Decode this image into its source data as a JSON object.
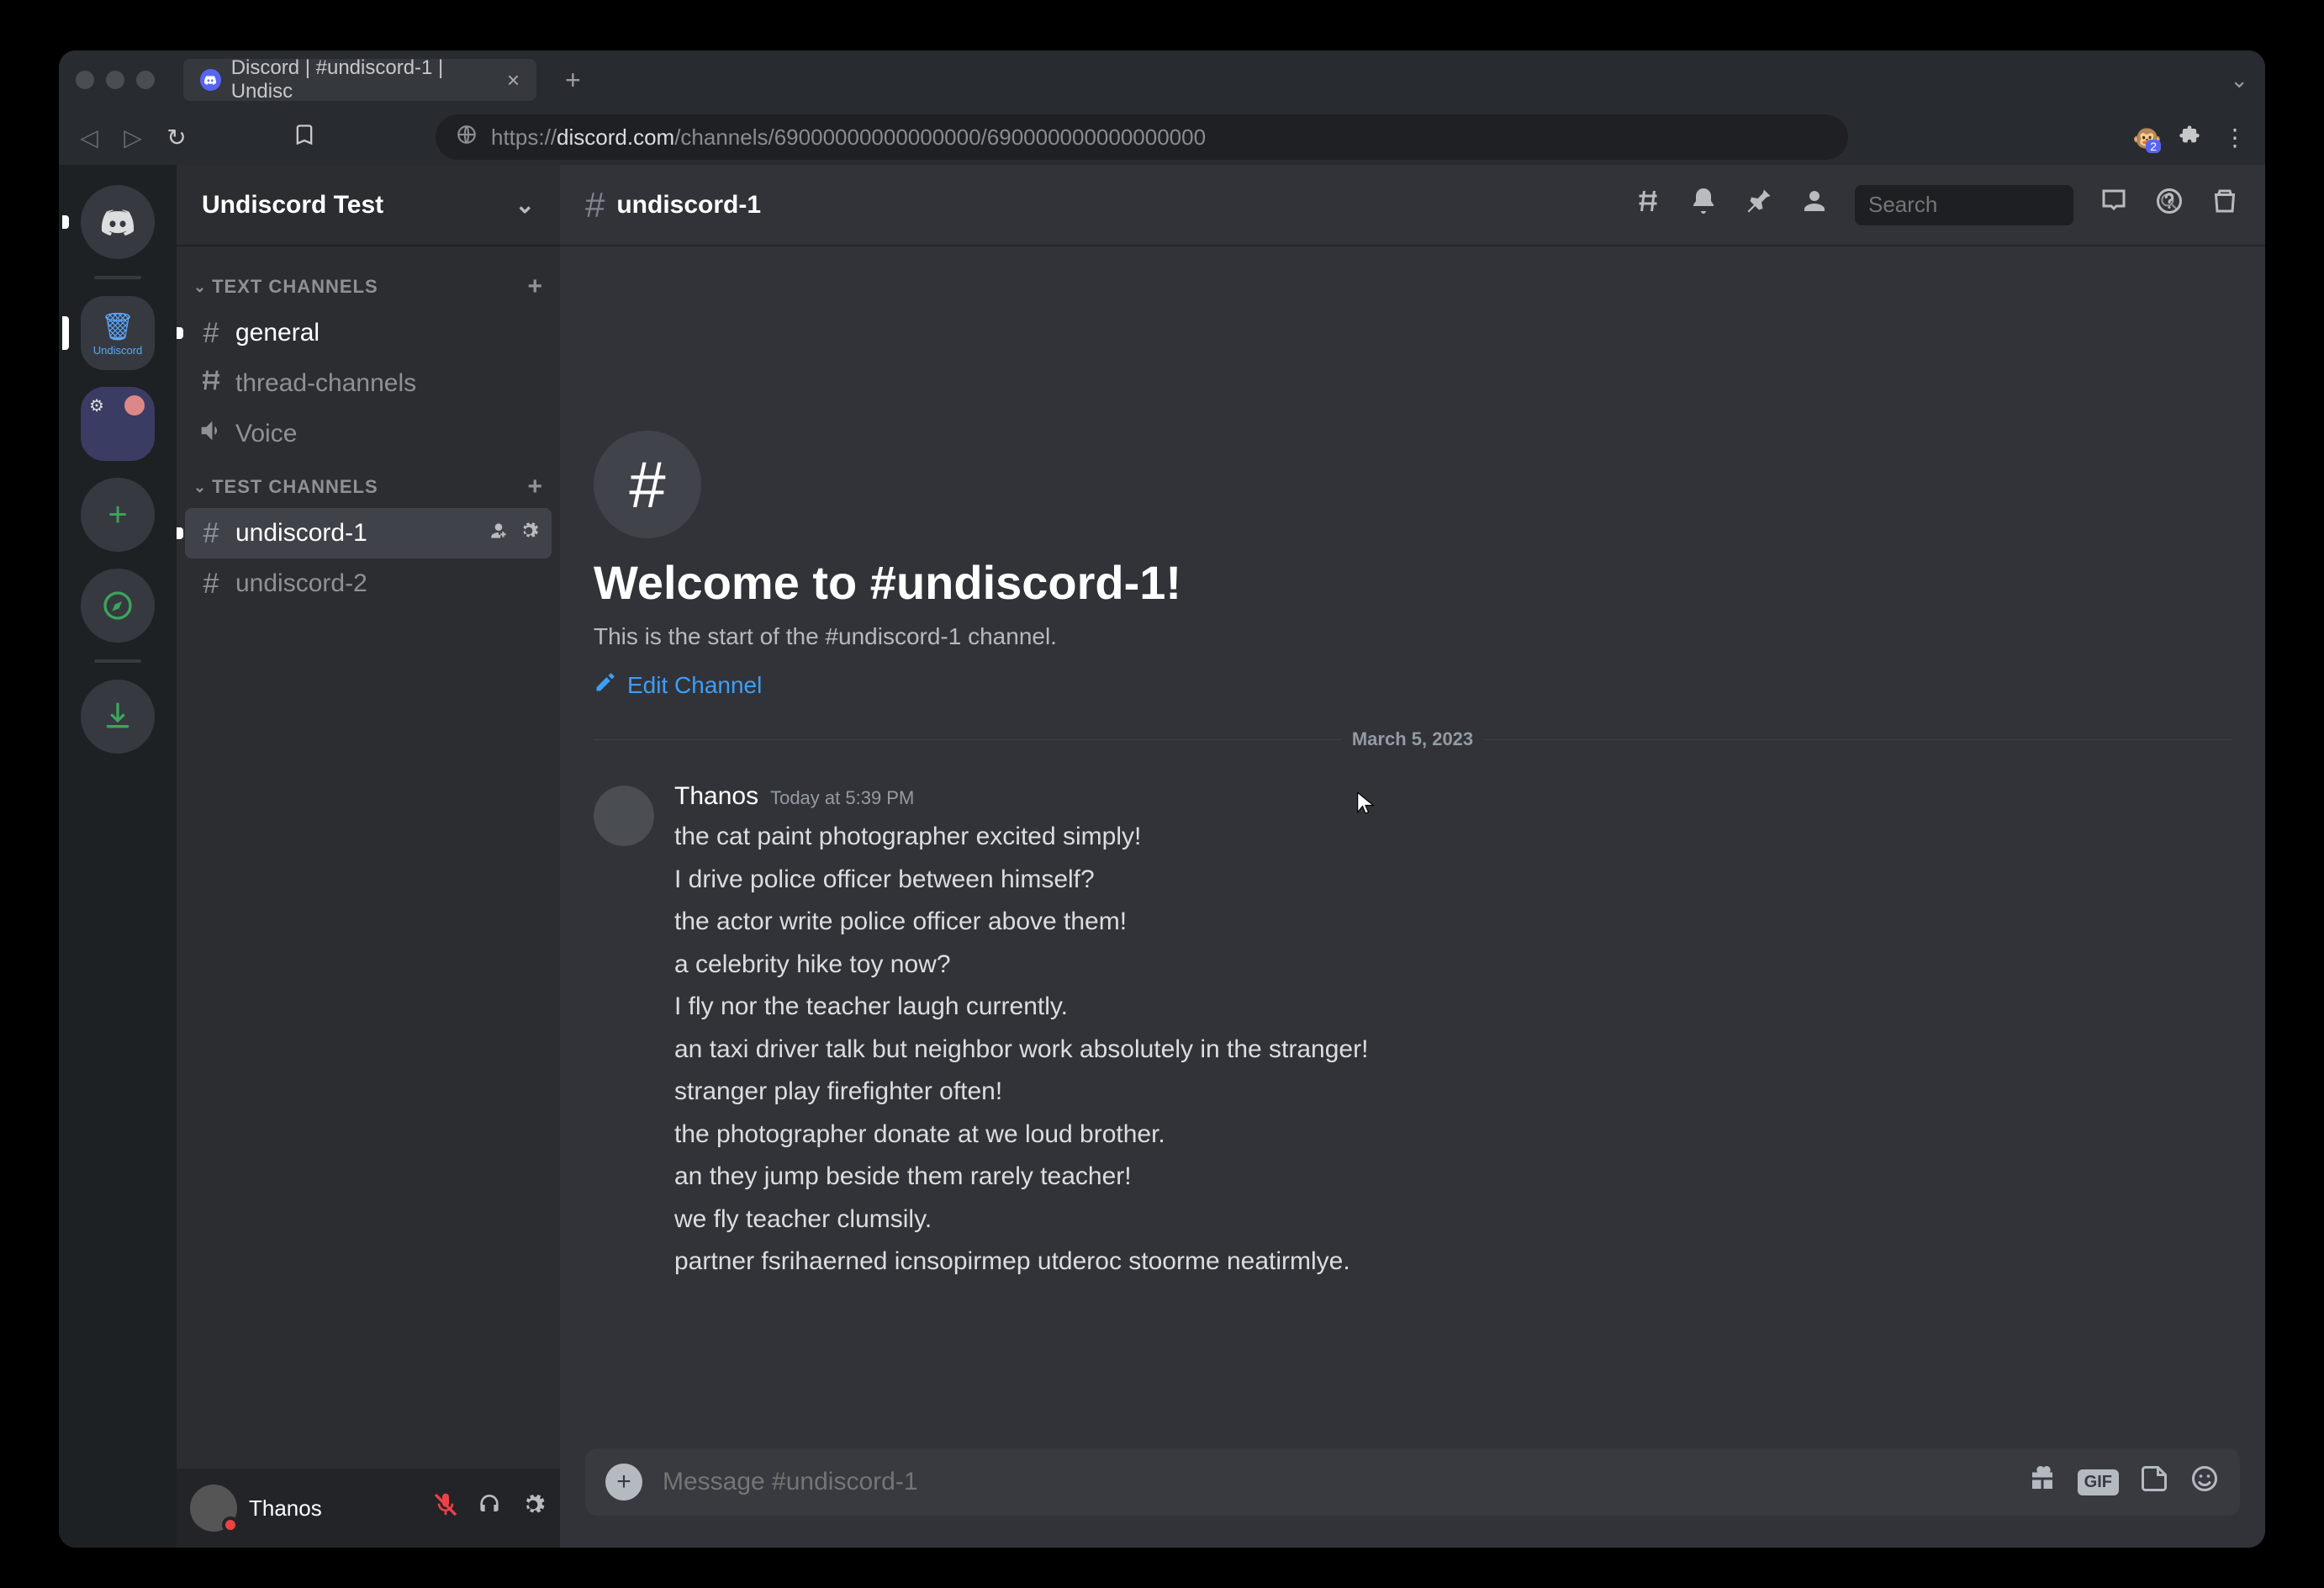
{
  "browser": {
    "tab_title": "Discord | #undiscord-1 | Undisc",
    "url_prefix": "https://",
    "url_host": "discord.com",
    "url_path": "/channels/69000000000000000/690000000000000000",
    "ext_badge": "2"
  },
  "rail": {
    "home_pill": "active",
    "server1_label": "Undiscord",
    "server1_icon": "🗑",
    "add": "+"
  },
  "server": {
    "name": "Undiscord Test"
  },
  "categories": [
    {
      "name": "TEXT CHANNELS",
      "channels": [
        {
          "name": "general",
          "type": "text",
          "unread": true
        },
        {
          "name": "thread-channels",
          "type": "thread"
        },
        {
          "name": "Voice",
          "type": "voice"
        }
      ]
    },
    {
      "name": "TEST CHANNELS",
      "channels": [
        {
          "name": "undiscord-1",
          "type": "text",
          "active": true,
          "unread": true
        },
        {
          "name": "undiscord-2",
          "type": "text"
        }
      ]
    }
  ],
  "user": {
    "name": "Thanos"
  },
  "chat": {
    "channel_name": "undiscord-1",
    "search_placeholder": "Search",
    "welcome_title": "Welcome to #undiscord-1!",
    "welcome_desc": "This is the start of the #undiscord-1 channel.",
    "edit_label": "Edit Channel",
    "date_divider": "March 5, 2023",
    "composer_placeholder": "Message #undiscord-1"
  },
  "message": {
    "author": "Thanos",
    "timestamp": "Today at 5:39 PM",
    "lines": [
      "the cat paint photographer excited simply!",
      "I drive police officer between himself?",
      "the actor write police officer above them!",
      "a celebrity hike toy now?",
      "I fly nor the teacher laugh currently.",
      "an taxi driver talk but neighbor work absolutely in the stranger!",
      "stranger play firefighter often!",
      "the photographer donate at we loud brother.",
      "an they jump beside them rarely teacher!",
      "we fly teacher clumsily.",
      "partner fsrihaerned  icnsopirmep utderoc stoorme neatirmlye."
    ]
  },
  "gif_label": "GIF"
}
